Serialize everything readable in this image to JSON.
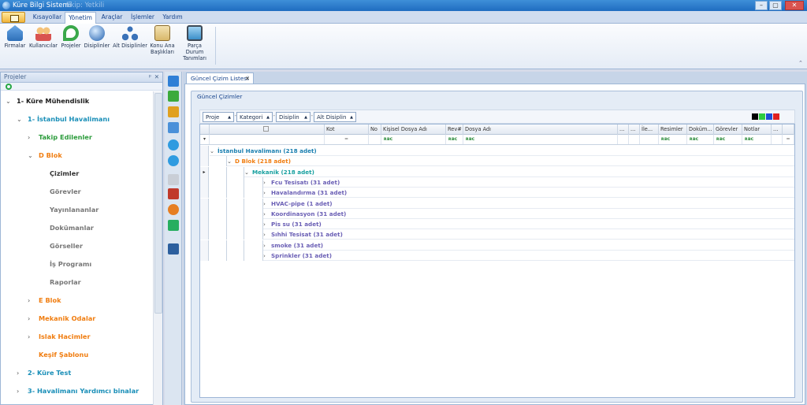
{
  "window": {
    "title": "Küre Bilgi Sistemi",
    "subtitle": "Ekip: Yetkili",
    "controls": [
      "–",
      "▢",
      "✕"
    ]
  },
  "ribbon_tabs": [
    {
      "label": "Kısayollar",
      "active": false
    },
    {
      "label": "Yönetim",
      "active": true
    },
    {
      "label": "Araçlar",
      "active": false
    },
    {
      "label": "İşlemler",
      "active": false
    },
    {
      "label": "Yardım",
      "active": false
    }
  ],
  "ribbon_buttons": [
    {
      "label": "Firmalar",
      "icon": "building-icon"
    },
    {
      "label": "Kullanıcılar",
      "icon": "users-icon"
    },
    {
      "label": "Projeler",
      "icon": "project-p-icon"
    },
    {
      "label": "Disiplinler",
      "icon": "globe-icon"
    },
    {
      "label": "Alt Disiplinler",
      "icon": "sub-discipline-icon"
    },
    {
      "label": "Konu Ana Başlıkları",
      "icon": "clipboard-check-icon"
    },
    {
      "label": "Parça Durum Tanımları",
      "icon": "monitor-icon"
    }
  ],
  "left_panel": {
    "title": "Projeler",
    "pin": "ᵖ",
    "close": "✕",
    "tree": [
      {
        "label": "1- Küre Mühendislik",
        "level": 0,
        "chev": "⌄",
        "color": "#1b1b1b"
      },
      {
        "label": "1- İstanbul Havalimanı",
        "level": 1,
        "chev": "⌄",
        "color": "#1a8fb8"
      },
      {
        "label": "Takip Edilenler",
        "level": 2,
        "chev": "›",
        "color": "#2c9c3c"
      },
      {
        "label": "D Blok",
        "level": 2,
        "chev": "⌄",
        "color": "#f07d10"
      },
      {
        "label": "Çizimler",
        "level": 3,
        "chev": "",
        "color": "#333333"
      },
      {
        "label": "Görevler",
        "level": 3,
        "chev": "",
        "color": "#777777"
      },
      {
        "label": "Yayınlananlar",
        "level": 3,
        "chev": "",
        "color": "#777777"
      },
      {
        "label": "Dokümanlar",
        "level": 3,
        "chev": "",
        "color": "#777777"
      },
      {
        "label": "Görseller",
        "level": 3,
        "chev": "",
        "color": "#777777"
      },
      {
        "label": "İş Programı",
        "level": 3,
        "chev": "",
        "color": "#777777"
      },
      {
        "label": "Raporlar",
        "level": 3,
        "chev": "",
        "color": "#777777"
      },
      {
        "label": "E Blok",
        "level": 2,
        "chev": "›",
        "color": "#f07d10"
      },
      {
        "label": "Mekanik Odalar",
        "level": 2,
        "chev": "›",
        "color": "#f07d10"
      },
      {
        "label": "Islak Hacimler",
        "level": 2,
        "chev": "›",
        "color": "#f07d10"
      },
      {
        "label": "Keşif Şablonu",
        "level": 2,
        "chev": "",
        "color": "#f07d10"
      },
      {
        "label": "2- Küre Test",
        "level": 1,
        "chev": "›",
        "color": "#1a8fb8"
      },
      {
        "label": "3- Havalimanı Yardımcı binalar",
        "level": 1,
        "chev": "›",
        "color": "#1a8fb8"
      }
    ]
  },
  "vertical_toolbar": [
    {
      "icon": "refresh-arrows-icon",
      "color": "#2f7fd6"
    },
    {
      "icon": "add-plus-icon",
      "color": "#3caa3c"
    },
    {
      "icon": "edit-pencil-icon",
      "color": "#e0a020"
    },
    {
      "icon": "delete-bin-icon",
      "color": "#4a90d9"
    },
    {
      "icon": "move-up-icon",
      "color": "#2f9be0"
    },
    {
      "icon": "move-down-icon",
      "color": "#2f9be0"
    },
    {
      "icon": "blank-doc-icon",
      "color": "#c9ced6"
    },
    {
      "icon": "stamp-icon",
      "color": "#c0392b"
    },
    {
      "icon": "cycle-icon",
      "color": "#e67e22"
    },
    {
      "icon": "export-icon",
      "color": "#27ae60"
    },
    {
      "icon": "external-link-icon",
      "color": "#2c5f9e"
    }
  ],
  "document": {
    "tab_label": "Güncel Çizim Listesi",
    "tab_close": "✕",
    "group_title": "Güncel Çizimler",
    "filters": [
      "Proje",
      "Kategori",
      "Disiplin",
      "Alt Disiplin"
    ],
    "filter_dropdown": "▲",
    "filter_separator": "-",
    "swatches": [
      "#000000",
      "#2ecc40",
      "#1f4fd6",
      "#e02020"
    ],
    "columns": [
      {
        "label": "",
        "key": "sel"
      },
      {
        "label": "Kot",
        "key": "kot"
      },
      {
        "label": "No",
        "key": "no"
      },
      {
        "label": "Kişisel Dosya Adı",
        "key": "kisisel"
      },
      {
        "label": "Rev#",
        "key": "rev"
      },
      {
        "label": "Dosya Adı",
        "key": "dosya"
      },
      {
        "label": "...",
        "key": "d1"
      },
      {
        "label": "...",
        "key": "d2"
      },
      {
        "label": "İle...",
        "key": "ile"
      },
      {
        "label": "Resimler",
        "key": "resimler"
      },
      {
        "label": "Doküm...",
        "key": "dokum"
      },
      {
        "label": "Görevler",
        "key": "gorevler"
      },
      {
        "label": "Notlar",
        "key": "notlar"
      },
      {
        "label": "...",
        "key": "d3"
      }
    ],
    "filter_row": {
      "eq": "═",
      "rbc": "ʀʙᴄ"
    },
    "groups": [
      {
        "label": "İstanbul Havalimanı (218 adet)",
        "level": 0,
        "chev": "⌄",
        "color": "#1a7fb0"
      },
      {
        "label": "D Blok (218 adet)",
        "level": 1,
        "chev": "⌄",
        "color": "#f07d10"
      },
      {
        "label": "Mekanik (218 adet)",
        "level": 2,
        "chev": "⌄",
        "color": "#18a0a0"
      },
      {
        "label": "Fcu Tesisatı (31 adet)",
        "level": 3,
        "chev": "›",
        "color": "#6a5fb5"
      },
      {
        "label": "Havalandırma (31 adet)",
        "level": 3,
        "chev": "›",
        "color": "#6a5fb5"
      },
      {
        "label": "HVAC-pipe (1 adet)",
        "level": 3,
        "chev": "›",
        "color": "#6a5fb5"
      },
      {
        "label": "Koordinasyon (31 adet)",
        "level": 3,
        "chev": "›",
        "color": "#6a5fb5"
      },
      {
        "label": "Pis su (31 adet)",
        "level": 3,
        "chev": "›",
        "color": "#6a5fb5"
      },
      {
        "label": "Sıhhi Tesisat (31 adet)",
        "level": 3,
        "chev": "›",
        "color": "#6a5fb5"
      },
      {
        "label": "smoke (31 adet)",
        "level": 3,
        "chev": "›",
        "color": "#6a5fb5"
      },
      {
        "label": "Sprinkler (31 adet)",
        "level": 3,
        "chev": "›",
        "color": "#6a5fb5"
      }
    ]
  }
}
